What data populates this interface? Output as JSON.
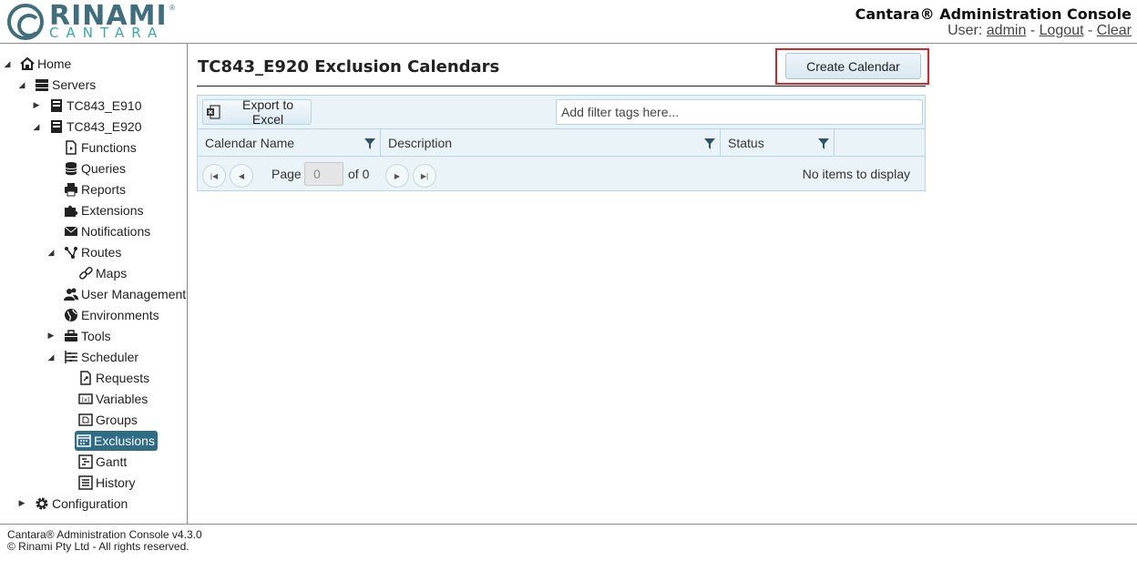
{
  "header": {
    "logo_text": "RINAMI",
    "logo_sub": "CANTARA",
    "logo_reg": "®",
    "app_title": "Cantara® Administration Console",
    "user_prefix": "User:",
    "user_name": "admin",
    "sep1": "-",
    "logout": "Logout",
    "sep2": "-",
    "clear": "Clear"
  },
  "sidebar": {
    "home": "Home",
    "servers": "Servers",
    "server1": "TC843_E910",
    "server2": "TC843_E920",
    "functions": "Functions",
    "queries": "Queries",
    "reports": "Reports",
    "extensions": "Extensions",
    "notifications": "Notifications",
    "routes": "Routes",
    "maps": "Maps",
    "user_management": "User Management",
    "environments": "Environments",
    "tools": "Tools",
    "scheduler": "Scheduler",
    "requests": "Requests",
    "variables": "Variables",
    "groups": "Groups",
    "exclusions": "Exclusions",
    "gantt": "Gantt",
    "history": "History",
    "configuration": "Configuration"
  },
  "main": {
    "title": "TC843_E920 Exclusion Calendars",
    "create_button": "Create Calendar",
    "export_button": "Export to Excel",
    "filter_placeholder": "Add filter tags here...",
    "columns": [
      "Calendar Name",
      "Description",
      "Status"
    ],
    "pager": {
      "page_label": "Page",
      "page_value": "0",
      "of_label": "of 0",
      "info": "No items to display"
    }
  },
  "footer": {
    "line1": "Cantara® Administration Console v4.3.0",
    "line2": "© Rinami Pty Ltd - All rights reserved."
  },
  "colors": {
    "accent": "#2f6c86",
    "logo": "#3f6f7f",
    "highlight": "#d9252a",
    "grid_bg": "#e9f3f8"
  }
}
